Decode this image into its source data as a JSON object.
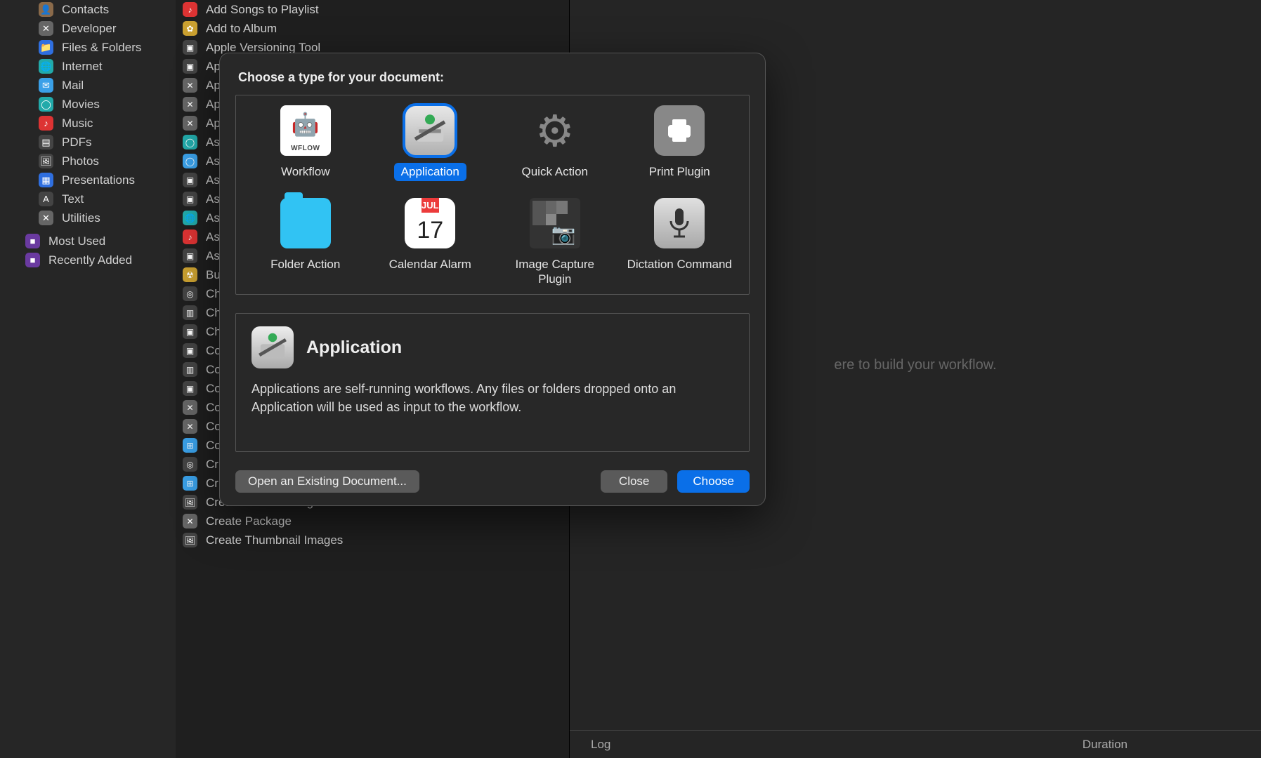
{
  "sidebar": {
    "items": [
      {
        "label": "Contacts",
        "iconClass": "bg-brown",
        "glyph": "👤"
      },
      {
        "label": "Developer",
        "iconClass": "bg-gray",
        "glyph": "✕"
      },
      {
        "label": "Files & Folders",
        "iconClass": "bg-blue",
        "glyph": "📁"
      },
      {
        "label": "Internet",
        "iconClass": "bg-teal",
        "glyph": "🌐"
      },
      {
        "label": "Mail",
        "iconClass": "bg-sky",
        "glyph": "✉"
      },
      {
        "label": "Movies",
        "iconClass": "bg-teal",
        "glyph": "◯"
      },
      {
        "label": "Music",
        "iconClass": "bg-red",
        "glyph": "♪"
      },
      {
        "label": "PDFs",
        "iconClass": "bg-dk",
        "glyph": "▤"
      },
      {
        "label": "Photos",
        "iconClass": "bg-dk",
        "glyph": "🖼"
      },
      {
        "label": "Presentations",
        "iconClass": "bg-blue",
        "glyph": "▦"
      },
      {
        "label": "Text",
        "iconClass": "bg-dk",
        "glyph": "A"
      },
      {
        "label": "Utilities",
        "iconClass": "bg-gray",
        "glyph": "✕"
      }
    ],
    "footerItems": [
      {
        "label": "Most Used",
        "iconClass": "bg-pp",
        "glyph": "■"
      },
      {
        "label": "Recently Added",
        "iconClass": "bg-pp",
        "glyph": "■"
      }
    ]
  },
  "actions": [
    {
      "label": "Add Songs to Playlist",
      "iconClass": "bg-red",
      "glyph": "♪"
    },
    {
      "label": "Add to Album",
      "iconClass": "bg-yellow",
      "glyph": "✿"
    },
    {
      "label": "Apple Versioning Tool",
      "iconClass": "bg-dk",
      "glyph": "▣"
    },
    {
      "label": "Ap",
      "iconClass": "bg-dk",
      "glyph": "▣"
    },
    {
      "label": "Ap",
      "iconClass": "bg-gray",
      "glyph": "✕"
    },
    {
      "label": "Ap",
      "iconClass": "bg-gray",
      "glyph": "✕"
    },
    {
      "label": "Ap",
      "iconClass": "bg-gray",
      "glyph": "✕"
    },
    {
      "label": "Asl",
      "iconClass": "bg-teal",
      "glyph": "◯"
    },
    {
      "label": "Asl",
      "iconClass": "bg-sky",
      "glyph": "◯"
    },
    {
      "label": "Asl",
      "iconClass": "bg-dk",
      "glyph": "▣"
    },
    {
      "label": "Asl",
      "iconClass": "bg-dk",
      "glyph": "▣"
    },
    {
      "label": "Asl",
      "iconClass": "bg-teal",
      "glyph": "🌐"
    },
    {
      "label": "Asl",
      "iconClass": "bg-red",
      "glyph": "♪"
    },
    {
      "label": "Asl",
      "iconClass": "bg-dk",
      "glyph": "▣"
    },
    {
      "label": "Bu",
      "iconClass": "bg-yellow",
      "glyph": "☢"
    },
    {
      "label": "Ch",
      "iconClass": "bg-dk",
      "glyph": "◎"
    },
    {
      "label": "Ch",
      "iconClass": "bg-dk",
      "glyph": "▥"
    },
    {
      "label": "Ch",
      "iconClass": "bg-dk",
      "glyph": "▣"
    },
    {
      "label": "Co",
      "iconClass": "bg-dk",
      "glyph": "▣"
    },
    {
      "label": "Co",
      "iconClass": "bg-dk",
      "glyph": "▥"
    },
    {
      "label": "Co",
      "iconClass": "bg-dk",
      "glyph": "▣"
    },
    {
      "label": "Co",
      "iconClass": "bg-gray",
      "glyph": "✕"
    },
    {
      "label": "Co",
      "iconClass": "bg-gray",
      "glyph": "✕"
    },
    {
      "label": "Co",
      "iconClass": "bg-sky",
      "glyph": "⊞"
    },
    {
      "label": "Cr",
      "iconClass": "bg-dk",
      "glyph": "◎"
    },
    {
      "label": "Cr",
      "iconClass": "bg-sky",
      "glyph": "⊞"
    },
    {
      "label": "Create Banner Image from Text",
      "iconClass": "bg-dk",
      "glyph": "🖼"
    },
    {
      "label": "Create Package",
      "iconClass": "bg-gray",
      "glyph": "✕"
    },
    {
      "label": "Create Thumbnail Images",
      "iconClass": "bg-dk",
      "glyph": "🖼"
    }
  ],
  "workflow": {
    "placeholder": "ere to build your workflow.",
    "log_label": "Log",
    "duration_label": "Duration"
  },
  "modal": {
    "title": "Choose a type for your document:",
    "types": [
      {
        "id": "workflow",
        "label": "Workflow"
      },
      {
        "id": "application",
        "label": "Application",
        "selected": true
      },
      {
        "id": "quick-action",
        "label": "Quick Action"
      },
      {
        "id": "print-plugin",
        "label": "Print Plugin"
      },
      {
        "id": "folder-action",
        "label": "Folder Action"
      },
      {
        "id": "calendar-alarm",
        "label": "Calendar Alarm"
      },
      {
        "id": "image-capture",
        "label": "Image Capture Plugin"
      },
      {
        "id": "dictation",
        "label": "Dictation Command"
      }
    ],
    "calendar": {
      "month": "JUL",
      "day": "17"
    },
    "desc": {
      "title": "Application",
      "text": "Applications are self-running workflows. Any files or folders dropped onto an Application will be used as input to the workflow."
    },
    "buttons": {
      "open": "Open an Existing Document...",
      "close": "Close",
      "choose": "Choose"
    }
  }
}
